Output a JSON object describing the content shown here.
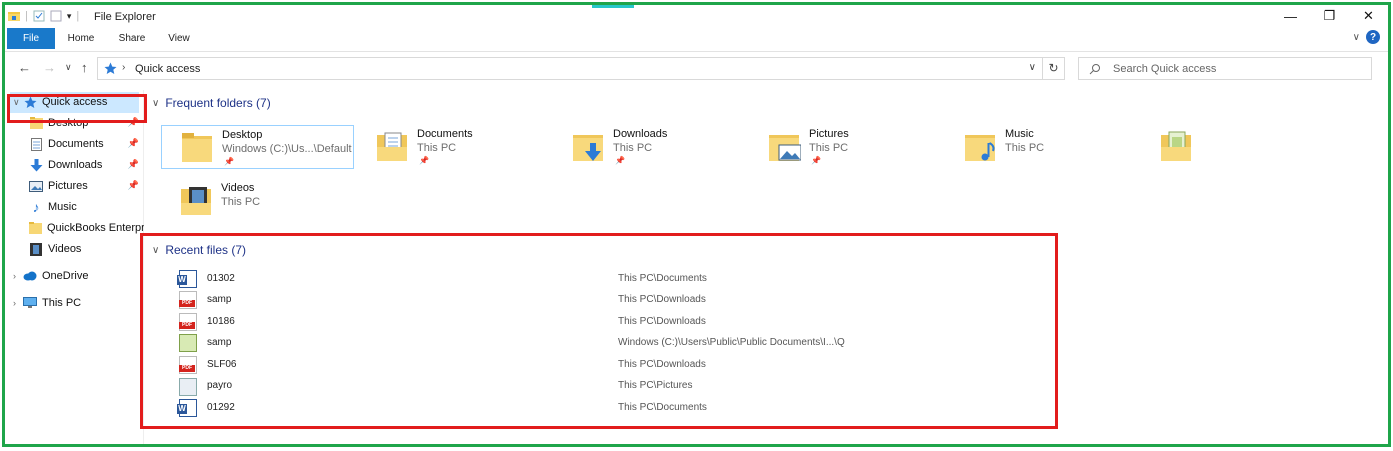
{
  "window": {
    "title": "File Explorer",
    "controls": {
      "minimize": "—",
      "maximize": "❐",
      "close": "✕"
    }
  },
  "ribbon": {
    "tabs": [
      "File",
      "Home",
      "Share",
      "View"
    ],
    "help_label": "?"
  },
  "address": {
    "crumb": "Quick access",
    "search_placeholder": "Search Quick access"
  },
  "sidebar": {
    "items": [
      {
        "label": "Quick access",
        "icon": "star-icon"
      },
      {
        "label": "Desktop",
        "icon": "folder-icon",
        "pinned": true
      },
      {
        "label": "Documents",
        "icon": "documents-icon",
        "pinned": true
      },
      {
        "label": "Downloads",
        "icon": "download-icon",
        "pinned": true
      },
      {
        "label": "Pictures",
        "icon": "pictures-icon",
        "pinned": true
      },
      {
        "label": "Music",
        "icon": "music-icon"
      },
      {
        "label": "QuickBooks Enterpr",
        "icon": "folder-icon"
      },
      {
        "label": "Videos",
        "icon": "videos-icon"
      },
      {
        "label": "OneDrive",
        "icon": "cloud-icon"
      },
      {
        "label": "This PC",
        "icon": "computer-icon"
      }
    ]
  },
  "frequent": {
    "header": "Frequent folders (7)",
    "folders": [
      {
        "name": "Desktop",
        "location": "Windows (C:)\\Us...\\Default",
        "pinned": true
      },
      {
        "name": "Documents",
        "location": "This PC",
        "pinned": true
      },
      {
        "name": "Downloads",
        "location": "This PC",
        "pinned": true
      },
      {
        "name": "Pictures",
        "location": "This PC",
        "pinned": true
      },
      {
        "name": "Music",
        "location": "This PC"
      },
      {
        "name": "",
        "location": ""
      },
      {
        "name": "Videos",
        "location": "This PC"
      }
    ]
  },
  "recent": {
    "header": "Recent files (7)",
    "files": [
      {
        "name": "01302",
        "location": "This PC\\Documents",
        "type": "word"
      },
      {
        "name": "samp",
        "location": "This PC\\Downloads",
        "type": "pdf"
      },
      {
        "name": "10186",
        "location": "This PC\\Downloads",
        "type": "pdf"
      },
      {
        "name": "samp",
        "location": "Windows (C:)\\Users\\Public\\Public Documents\\I...\\Q",
        "type": "spreadsheet"
      },
      {
        "name": "SLF06",
        "location": "This PC\\Downloads",
        "type": "pdf"
      },
      {
        "name": "payro",
        "location": "This PC\\Pictures",
        "type": "image"
      },
      {
        "name": "01292",
        "location": "This PC\\Documents",
        "type": "word"
      }
    ]
  },
  "colors": {
    "accent": "#1979ca",
    "frame": "#1fa54a",
    "highlight": "#e21c1c",
    "group_header": "#1e3287"
  }
}
